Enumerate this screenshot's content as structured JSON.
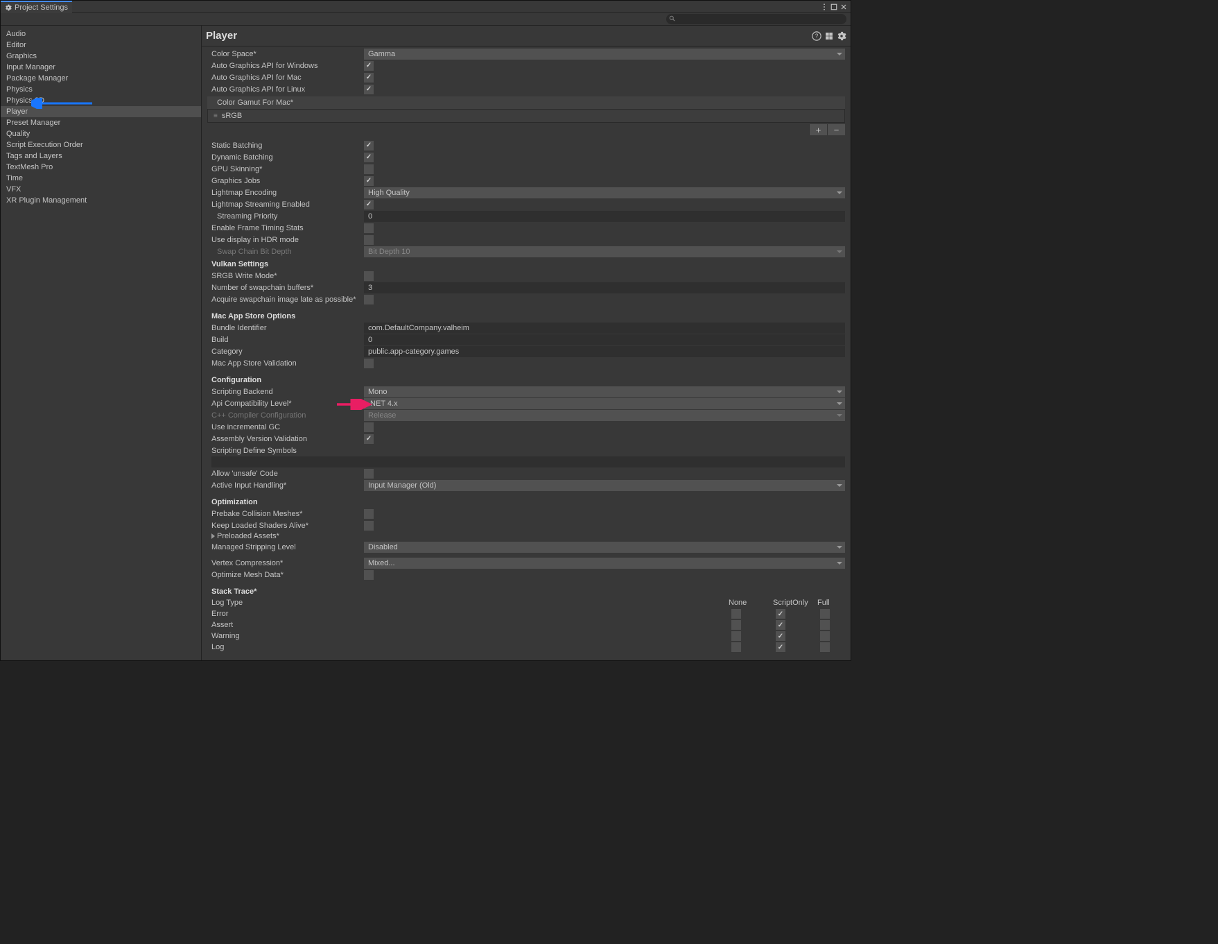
{
  "window": {
    "title": "Project Settings"
  },
  "search": {
    "placeholder": ""
  },
  "sidebar": {
    "items": [
      {
        "label": "Audio"
      },
      {
        "label": "Editor"
      },
      {
        "label": "Graphics"
      },
      {
        "label": "Input Manager"
      },
      {
        "label": "Package Manager"
      },
      {
        "label": "Physics"
      },
      {
        "label": "Physics 2D"
      },
      {
        "label": "Player",
        "selected": true
      },
      {
        "label": "Preset Manager"
      },
      {
        "label": "Quality"
      },
      {
        "label": "Script Execution Order"
      },
      {
        "label": "Tags and Layers"
      },
      {
        "label": "TextMesh Pro"
      },
      {
        "label": "Time"
      },
      {
        "label": "VFX"
      },
      {
        "label": "XR Plugin Management"
      }
    ]
  },
  "main": {
    "title": "Player",
    "rows": {
      "colorSpace": {
        "label": "Color Space*",
        "value": "Gamma"
      },
      "autoWin": {
        "label": "Auto Graphics API  for Windows",
        "checked": true
      },
      "autoMac": {
        "label": "Auto Graphics API  for Mac",
        "checked": true
      },
      "autoLinux": {
        "label": "Auto Graphics API  for Linux",
        "checked": true
      },
      "gamutHeader": "Color Gamut For Mac*",
      "gamutItem": "sRGB",
      "staticBatch": {
        "label": "Static Batching",
        "checked": true
      },
      "dynBatch": {
        "label": "Dynamic Batching",
        "checked": true
      },
      "gpuSkin": {
        "label": "GPU Skinning*",
        "checked": false
      },
      "gfxJobs": {
        "label": "Graphics Jobs",
        "checked": true
      },
      "lmEncoding": {
        "label": "Lightmap Encoding",
        "value": "High Quality"
      },
      "lmStream": {
        "label": "Lightmap Streaming Enabled",
        "checked": true
      },
      "streamPri": {
        "label": "Streaming Priority",
        "value": "0"
      },
      "frameTiming": {
        "label": "Enable Frame Timing Stats",
        "checked": false
      },
      "hdr": {
        "label": "Use display in HDR mode",
        "checked": false
      },
      "swapBit": {
        "label": "Swap Chain Bit Depth",
        "value": "Bit Depth 10"
      },
      "vulkanHdr": "Vulkan Settings",
      "srgbWrite": {
        "label": "SRGB Write Mode*",
        "checked": false
      },
      "swapBuf": {
        "label": "Number of swapchain buffers*",
        "value": "3"
      },
      "acqLate": {
        "label": "Acquire swapchain image late as possible*",
        "checked": false
      },
      "macStoreHdr": "Mac App Store Options",
      "bundleId": {
        "label": "Bundle Identifier",
        "value": "com.DefaultCompany.valheim"
      },
      "build": {
        "label": "Build",
        "value": "0"
      },
      "category": {
        "label": "Category",
        "value": "public.app-category.games"
      },
      "macValid": {
        "label": "Mac App Store Validation",
        "checked": false
      },
      "configHdr": "Configuration",
      "backend": {
        "label": "Scripting Backend",
        "value": "Mono"
      },
      "apiCompat": {
        "label": "Api Compatibility Level*",
        "value": ".NET 4.x"
      },
      "cppCfg": {
        "label": "C++ Compiler Configuration",
        "value": "Release"
      },
      "incGC": {
        "label": "Use incremental GC",
        "checked": false
      },
      "asmValid": {
        "label": "Assembly Version Validation",
        "checked": true
      },
      "defSym": {
        "label": "Scripting Define Symbols",
        "value": ""
      },
      "unsafe": {
        "label": "Allow 'unsafe' Code",
        "checked": false
      },
      "inputHandling": {
        "label": "Active Input Handling*",
        "value": "Input Manager (Old)"
      },
      "optHdr": "Optimization",
      "prebake": {
        "label": "Prebake Collision Meshes*",
        "checked": false
      },
      "keepShaders": {
        "label": "Keep Loaded Shaders Alive*",
        "checked": false
      },
      "preloaded": {
        "label": "Preloaded Assets*"
      },
      "stripLevel": {
        "label": "Managed Stripping Level",
        "value": "Disabled"
      },
      "vertComp": {
        "label": "Vertex Compression*",
        "value": "Mixed..."
      },
      "optMesh": {
        "label": "Optimize Mesh Data*",
        "checked": false
      },
      "stackHdr": "Stack Trace*",
      "stackCols": {
        "c0": "Log Type",
        "c1": "None",
        "c2": "ScriptOnly",
        "c3": "Full"
      },
      "stackRows": [
        {
          "label": "Error",
          "none": false,
          "script": true,
          "full": false
        },
        {
          "label": "Assert",
          "none": false,
          "script": true,
          "full": false
        },
        {
          "label": "Warning",
          "none": false,
          "script": true,
          "full": false
        },
        {
          "label": "Log",
          "none": false,
          "script": true,
          "full": false
        }
      ]
    }
  }
}
